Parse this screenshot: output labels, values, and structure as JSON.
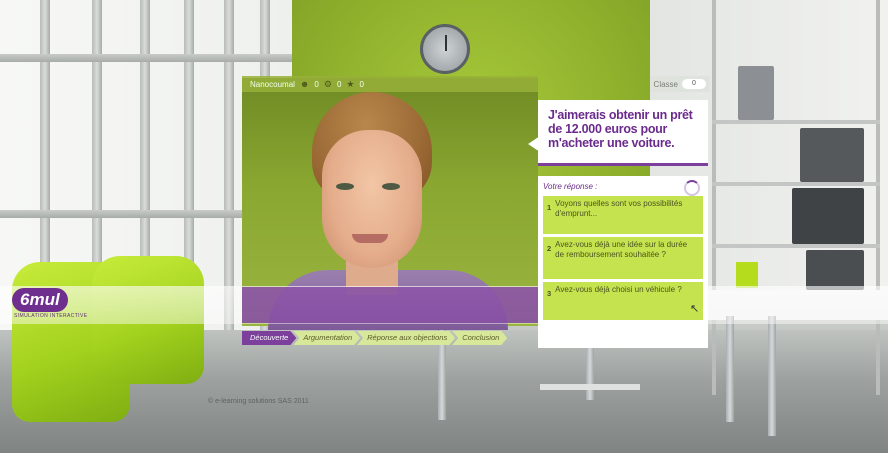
{
  "status_bar": {
    "label": "Nanocoumal",
    "counter_1": "0",
    "counter_2": "0",
    "counter_3": "0"
  },
  "score": {
    "label": "Classe",
    "value": "0"
  },
  "question": {
    "text": "J'aimerais obtenir un prêt de 12.000 euros pour m'acheter une voiture."
  },
  "answer_panel": {
    "title": "Votre réponse :",
    "options": [
      {
        "num": "1",
        "text": "Voyons quelles sont vos possibilités d'emprunt..."
      },
      {
        "num": "2",
        "text": "Avez-vous déjà une idée sur la durée de remboursement souhaitée ?"
      },
      {
        "num": "3",
        "text": "Avez-vous déjà choisi un véhicule ?"
      }
    ]
  },
  "steps": [
    {
      "label": "Découverte",
      "active": true
    },
    {
      "label": "Argumentation",
      "active": false
    },
    {
      "label": "Réponse aux objections",
      "active": false
    },
    {
      "label": "Conclusion",
      "active": false
    }
  ],
  "logo": {
    "mark": "6mul",
    "subtitle": "SIMULATION INTERACTIVE"
  },
  "copyright": "© e-learning solutions SAS 2011",
  "colors": {
    "accent_purple": "#7c3f9b",
    "option_green": "#c5e24f",
    "wall_green": "#8fb02c"
  },
  "icons": {
    "user": "user-icon",
    "gear": "gear-icon",
    "star": "star-icon",
    "spinner": "loading-icon",
    "cursor": "pointer-cursor-icon"
  }
}
